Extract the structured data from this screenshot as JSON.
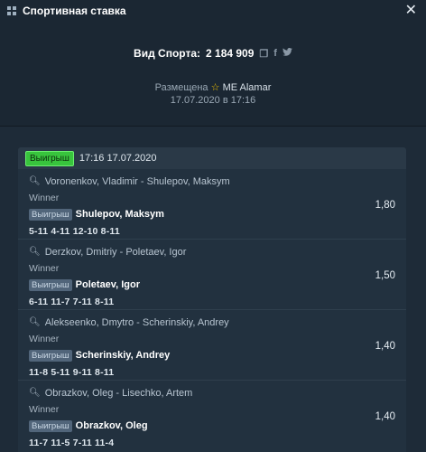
{
  "window": {
    "title": "Спортивная ставка",
    "close_label": "✕"
  },
  "bet": {
    "label": "Вид Спорта:",
    "id": "2 184 909",
    "placed_label": "Размещена",
    "user": "ME Alamar",
    "placed_date": "17.07.2020 в 17:16"
  },
  "card": {
    "status": "Выигрыш",
    "datetime": "17:16 17.07.2020"
  },
  "events": [
    {
      "match": "Voronenkov, Vladimir - Shulepov, Maksym",
      "market": "Winner",
      "badge": "Выигрыш",
      "selection": "Shulepov, Maksym",
      "odds": "1,80",
      "score": "5-11 4-11 12-10 8-11"
    },
    {
      "match": "Derzkov, Dmitriy - Poletaev, Igor",
      "market": "Winner",
      "badge": "Выигрыш",
      "selection": "Poletaev, Igor",
      "odds": "1,50",
      "score": "6-11 11-7 7-11 8-11"
    },
    {
      "match": "Alekseenko, Dmytro - Scherinskiy, Andrey",
      "market": "Winner",
      "badge": "Выигрыш",
      "selection": "Scherinskiy, Andrey",
      "odds": "1,40",
      "score": "11-8 5-11 9-11 8-11"
    },
    {
      "match": "Obrazkov, Oleg - Lisechko, Artem",
      "market": "Winner",
      "badge": "Выигрыш",
      "selection": "Obrazkov, Oleg",
      "odds": "1,40",
      "score": "11-7 11-5 7-11 11-4"
    }
  ]
}
